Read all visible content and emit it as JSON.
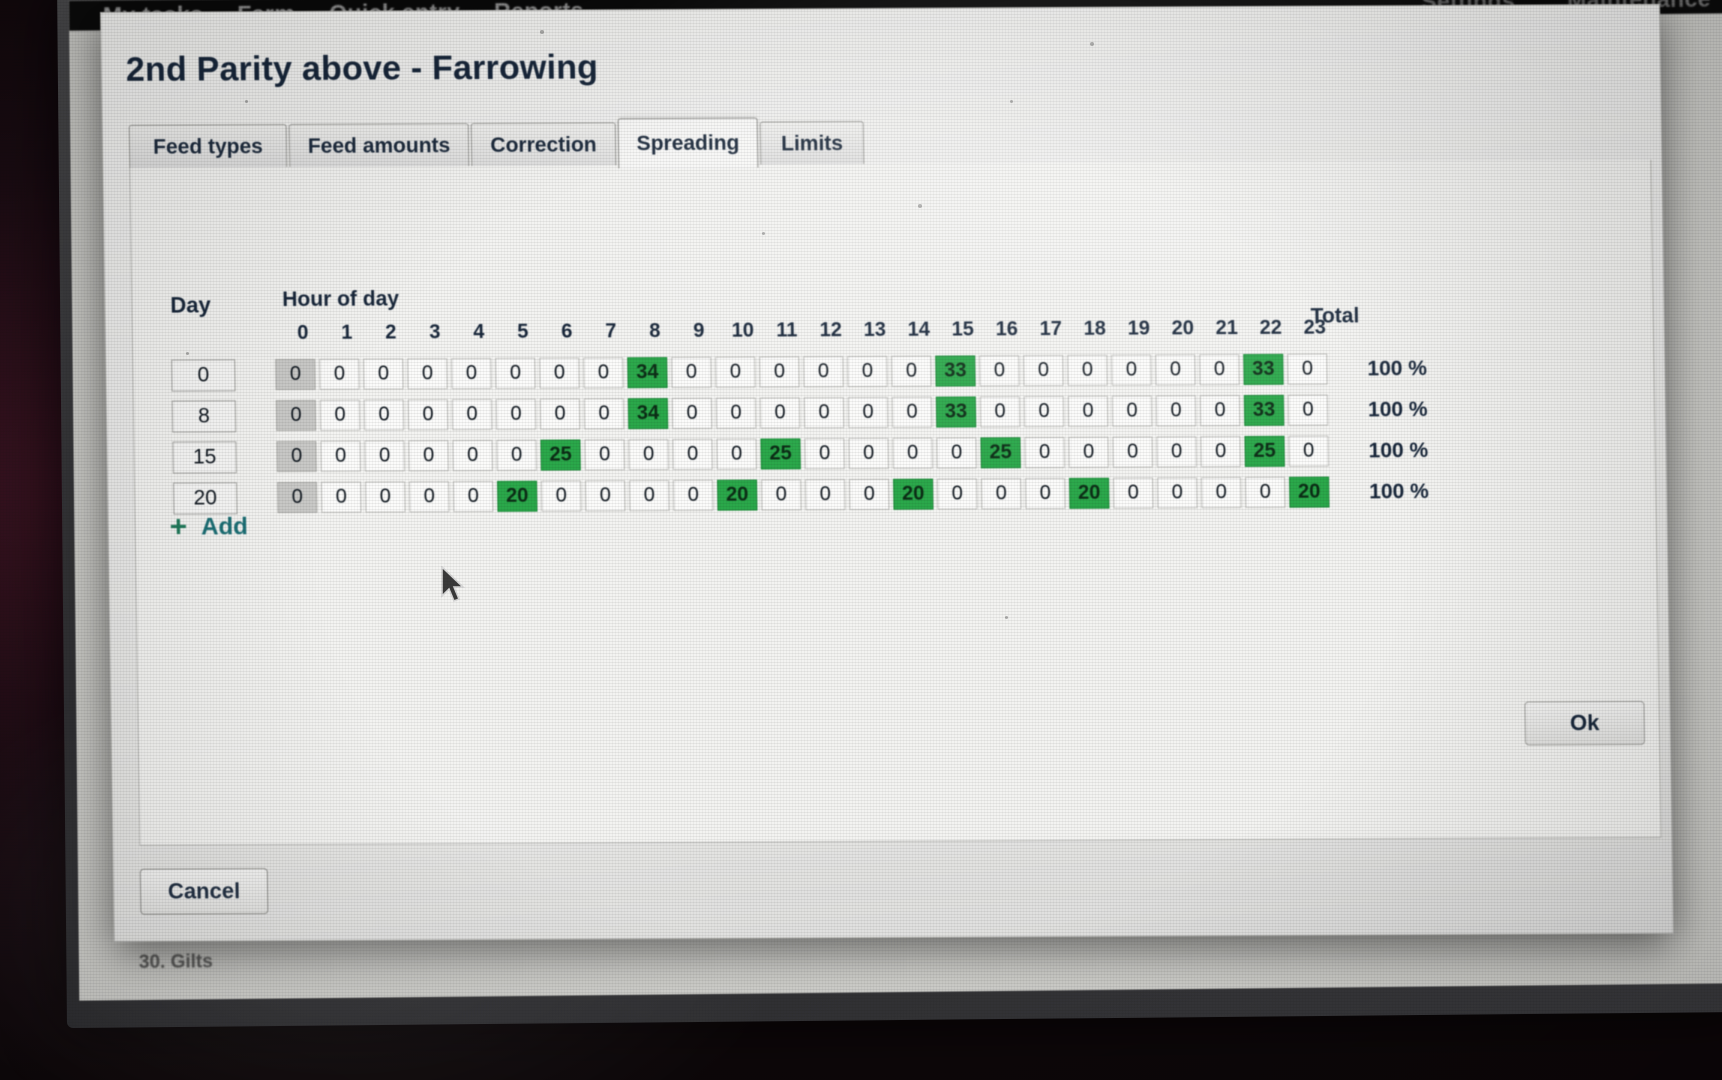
{
  "app": {
    "menubar_left": [
      "My tasks",
      "Farm",
      "Quick entry",
      "Reports"
    ],
    "menubar_right": [
      "Settings",
      "Maintenance"
    ],
    "status_label": "30. Gilts"
  },
  "dialog": {
    "title": "2nd Parity above - Farrowing",
    "tabs": [
      {
        "label": "Feed types",
        "active": false
      },
      {
        "label": "Feed amounts",
        "active": false
      },
      {
        "label": "Correction",
        "active": false
      },
      {
        "label": "Spreading",
        "active": true
      },
      {
        "label": "Limits",
        "active": false
      }
    ],
    "add_label": "Add",
    "add_icon": "plus-icon",
    "cancel_label": "Cancel",
    "ok_label": "Ok"
  },
  "table": {
    "day_header": "Day",
    "hour_header": "Hour of day",
    "total_header": "Total",
    "hours": [
      "0",
      "1",
      "2",
      "3",
      "4",
      "5",
      "6",
      "7",
      "8",
      "9",
      "10",
      "11",
      "12",
      "13",
      "14",
      "15",
      "16",
      "17",
      "18",
      "19",
      "20",
      "21",
      "22",
      "23"
    ],
    "rows": [
      {
        "day": "0",
        "values": [
          "0",
          "0",
          "0",
          "0",
          "0",
          "0",
          "0",
          "0",
          "34",
          "0",
          "0",
          "0",
          "0",
          "0",
          "0",
          "33",
          "0",
          "0",
          "0",
          "0",
          "0",
          "0",
          "33",
          "0"
        ],
        "highlight": [
          8,
          15,
          22
        ],
        "total": "100 %"
      },
      {
        "day": "8",
        "values": [
          "0",
          "0",
          "0",
          "0",
          "0",
          "0",
          "0",
          "0",
          "34",
          "0",
          "0",
          "0",
          "0",
          "0",
          "0",
          "33",
          "0",
          "0",
          "0",
          "0",
          "0",
          "0",
          "33",
          "0"
        ],
        "highlight": [
          8,
          15,
          22
        ],
        "total": "100 %"
      },
      {
        "day": "15",
        "values": [
          "0",
          "0",
          "0",
          "0",
          "0",
          "0",
          "25",
          "0",
          "0",
          "0",
          "0",
          "25",
          "0",
          "0",
          "0",
          "0",
          "25",
          "0",
          "0",
          "0",
          "0",
          "0",
          "25",
          "0"
        ],
        "highlight": [
          6,
          11,
          16,
          22
        ],
        "total": "100 %"
      },
      {
        "day": "20",
        "values": [
          "0",
          "0",
          "0",
          "0",
          "0",
          "20",
          "0",
          "0",
          "0",
          "0",
          "20",
          "0",
          "0",
          "0",
          "20",
          "0",
          "0",
          "0",
          "20",
          "0",
          "0",
          "0",
          "0",
          "20"
        ],
        "highlight": [
          5,
          10,
          14,
          18,
          23
        ],
        "total": "100 %"
      }
    ]
  },
  "colors": {
    "highlight_green": "#2aa84a",
    "title_navy": "#17263a",
    "link_teal": "#1b6f75",
    "dialog_bg": "#f2f2f0"
  }
}
